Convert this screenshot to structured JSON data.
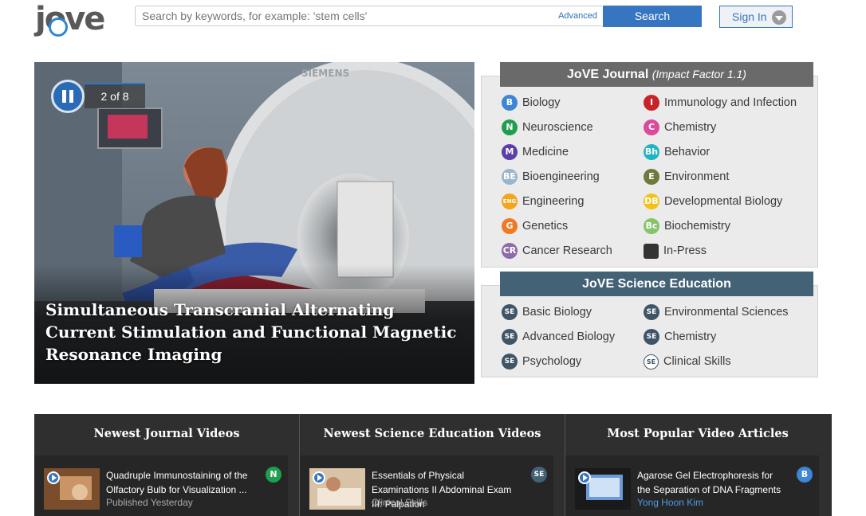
{
  "header": {
    "logo_text": "jove",
    "search_placeholder": "Search by keywords, for example: 'stem cells'",
    "advanced_label": "Advanced",
    "search_label": "Search",
    "signin_label": "Sign In"
  },
  "hero": {
    "slide_counter": "2 of 8",
    "title": "Simultaneous Transcranial Alternating Current Stimulation and Functional Magnetic Resonance Imaging",
    "scanner_brand": "SIEMENS"
  },
  "journal": {
    "title": "JoVE Journal",
    "subtitle": "(Impact Factor 1.1)",
    "header_color": "#6a6a6a",
    "left": [
      {
        "label": "Biology",
        "badge": "B",
        "color": "#3c86d5"
      },
      {
        "label": "Neuroscience",
        "badge": "N",
        "color": "#1e9e4f"
      },
      {
        "label": "Medicine",
        "badge": "M",
        "color": "#5b3ea9"
      },
      {
        "label": "Bioengineering",
        "badge": "BE",
        "color": "#9bb6cc"
      },
      {
        "label": "Engineering",
        "badge": "ENG",
        "color": "#f3a51f"
      },
      {
        "label": "Genetics",
        "badge": "G",
        "color": "#f07a24"
      },
      {
        "label": "Cancer Research",
        "badge": "CR",
        "color": "#8d6aa8"
      }
    ],
    "right": [
      {
        "label": "Immunology and Infection",
        "badge": "I",
        "color": "#c8232a"
      },
      {
        "label": "Chemistry",
        "badge": "C",
        "color": "#d94b9e"
      },
      {
        "label": "Behavior",
        "badge": "Bh",
        "color": "#1fb5c4"
      },
      {
        "label": "Environment",
        "badge": "E",
        "color": "#6e7a3b"
      },
      {
        "label": "Developmental Biology",
        "badge": "DB",
        "color": "#f2c21a"
      },
      {
        "label": "Biochemistry",
        "badge": "Bc",
        "color": "#86c36b"
      },
      {
        "label": "In-Press",
        "badge": "",
        "color": "#333333"
      }
    ]
  },
  "education": {
    "title": "JoVE Science Education",
    "header_color": "#436275",
    "badge_text": "SE",
    "left": [
      "Basic Biology",
      "Advanced Biology",
      "Psychology"
    ],
    "right": [
      "Environmental Sciences",
      "Chemistry",
      "Clinical Skills"
    ]
  },
  "bottom": {
    "columns": [
      {
        "heading": "Newest Journal Videos",
        "title": "Quadruple Immunostaining of the Olfactory Bulb for Visualization ...",
        "meta": "Published Yesterday",
        "badge": "N",
        "badge_color": "#1e9e4f"
      },
      {
        "heading": "Newest Science Education Videos",
        "title": "Essentials of Physical Examinations II Abdominal Exam III: Palpation",
        "meta": "Clinical Skills",
        "badge": "SE",
        "badge_color": "#436275"
      },
      {
        "heading": "Most Popular Video Articles",
        "title": "Agarose Gel Electrophoresis for the Separation of DNA Fragments",
        "author": "Yong Hoon Kim",
        "badge": "B",
        "badge_color": "#3c86d5"
      }
    ]
  }
}
